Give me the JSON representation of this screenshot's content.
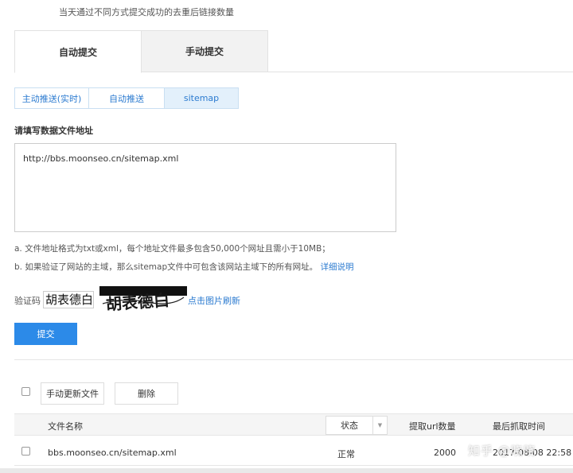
{
  "top_note": "当天通过不同方式提交成功的去重后链接数量",
  "tabs": [
    {
      "label": "自动提交",
      "active": true
    },
    {
      "label": "手动提交",
      "active": false
    }
  ],
  "subtabs": [
    {
      "label": "主动推送(实时)",
      "selected": false
    },
    {
      "label": "自动推送",
      "selected": false
    },
    {
      "label": "sitemap",
      "selected": true
    }
  ],
  "form": {
    "section_label": "请填写数据文件地址",
    "url_value": "http://bbs.moonseo.cn/sitemap.xml",
    "hint_a": "a. 文件地址格式为txt或xml，每个地址文件最多包含50,000个网址且需小于10MB；",
    "hint_b": "b. 如果验证了网站的主域，那么sitemap文件中可包含该网站主域下的所有网址。",
    "hint_b_link": "详细说明",
    "captcha_label": "验证码",
    "captcha_value": "胡表德白",
    "captcha_image_text": "胡表德白",
    "refresh_link": "点击图片刷新",
    "submit_label": "提交"
  },
  "toolbar": {
    "update_label": "手动更新文件",
    "delete_label": "删除"
  },
  "table": {
    "headers": {
      "file_name": "文件名称",
      "status": "状态",
      "url_count": "提取url数量",
      "last_fetch": "最后抓取时间"
    },
    "rows": [
      {
        "file_name": "bbs.moonseo.cn/sitemap.xml",
        "status": "正常",
        "url_count": "2000",
        "last_fetch": "2017-08-08 22:58"
      }
    ]
  },
  "watermark": "知乎 @晓晓",
  "colors": {
    "accent": "#2c8ae8",
    "link": "#2c7bd0",
    "subtab_selected_bg": "#e3f0fb"
  }
}
